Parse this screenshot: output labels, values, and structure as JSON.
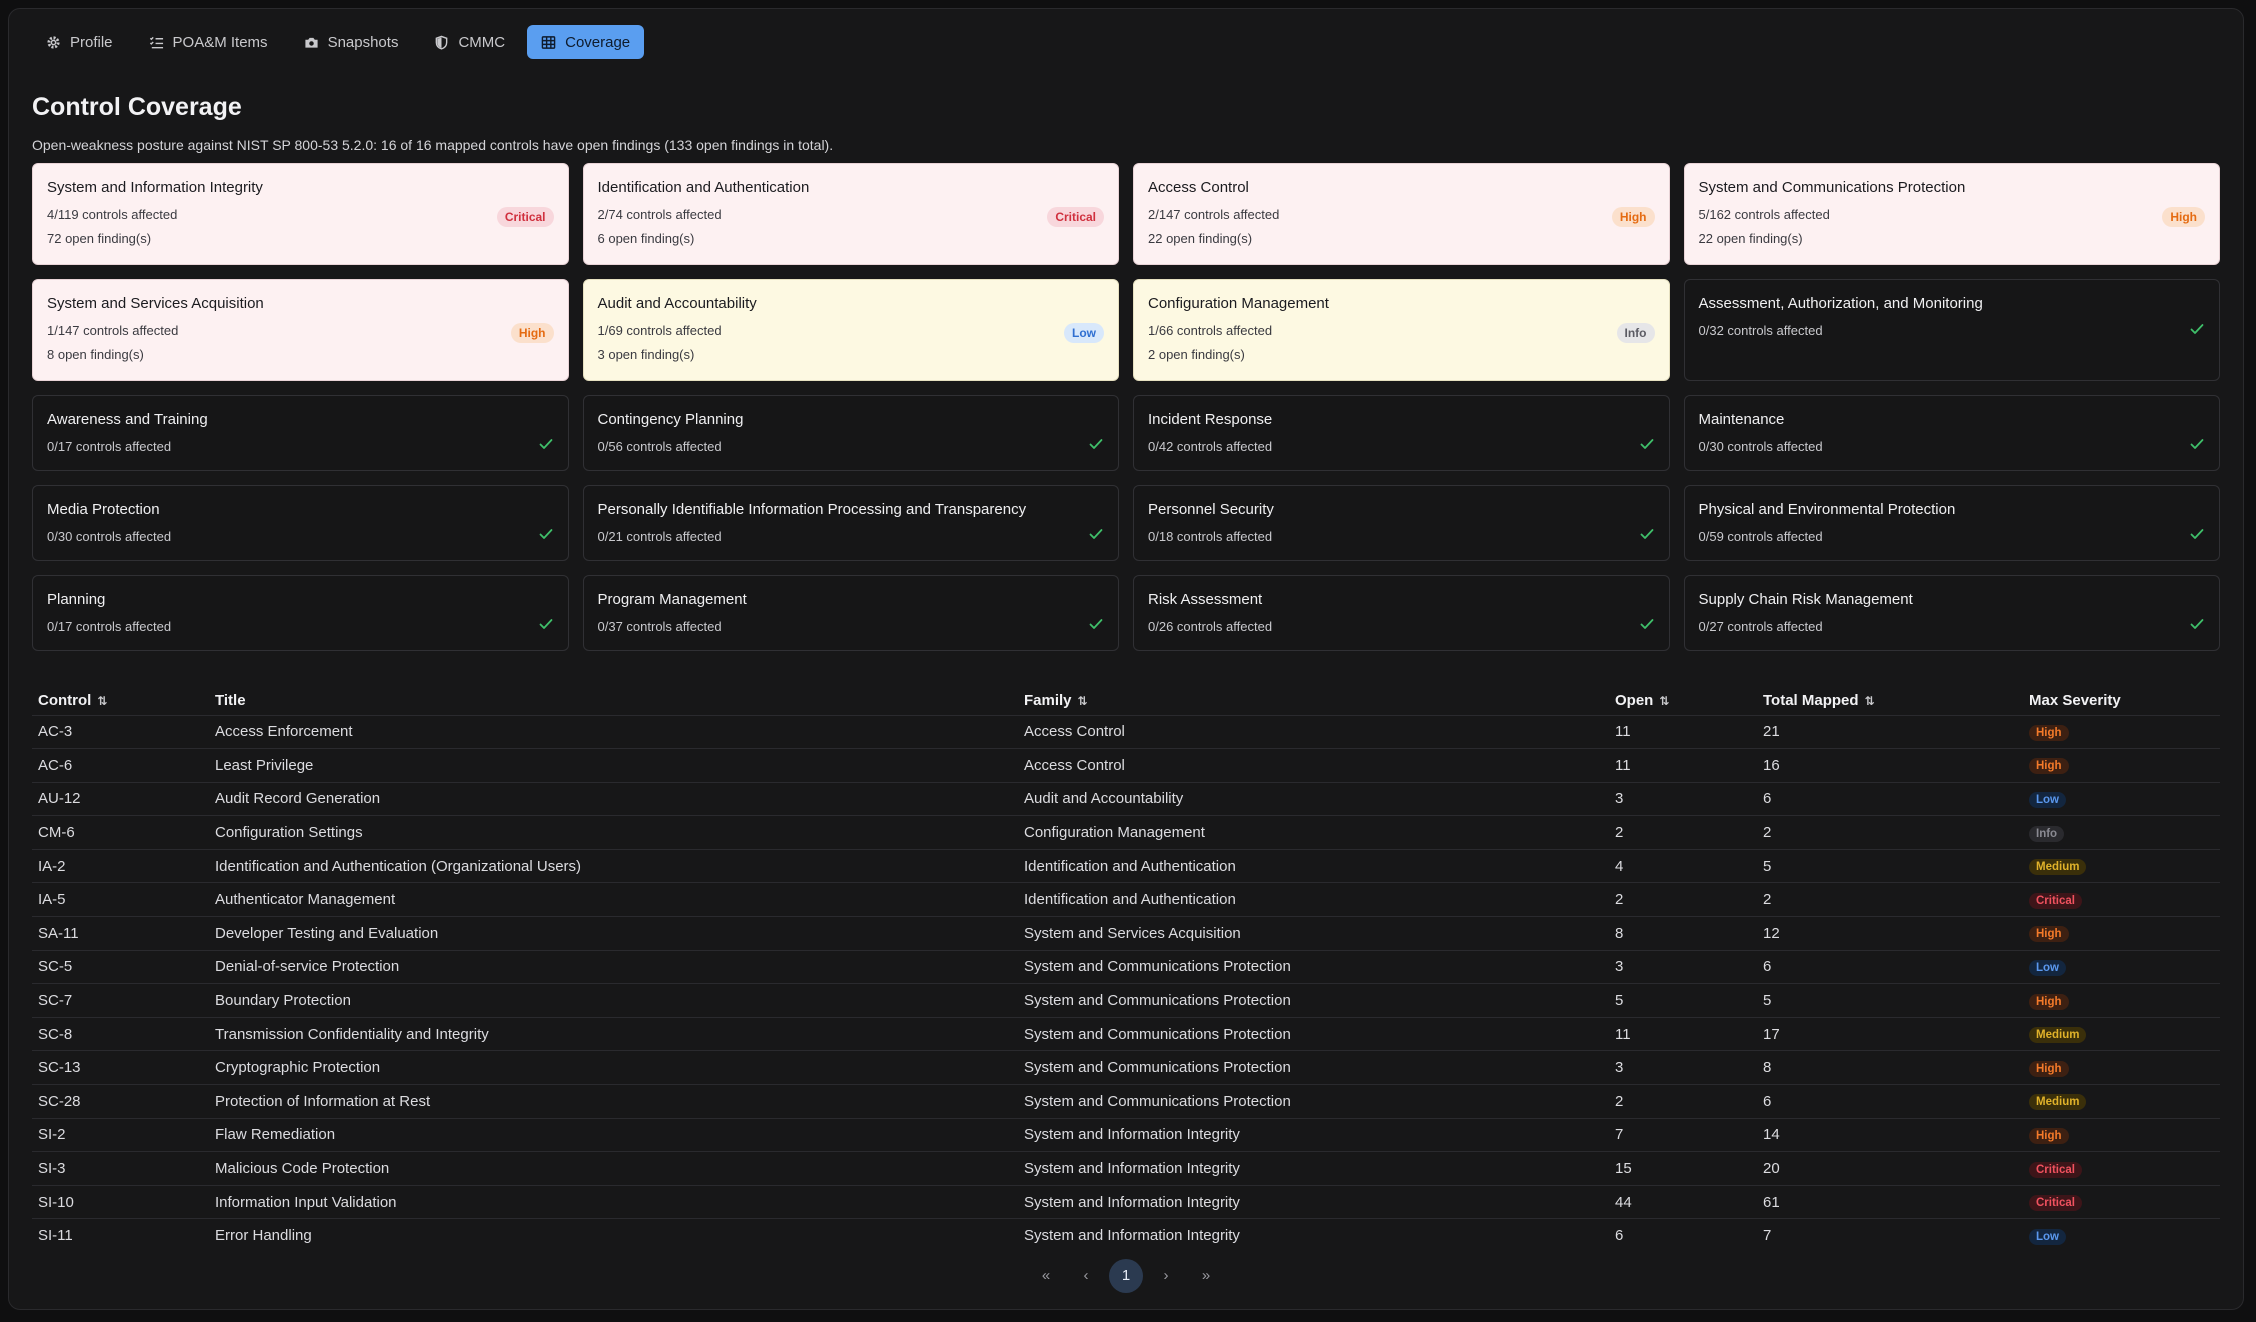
{
  "tabs": [
    {
      "label": "Profile",
      "icon": "gear-icon"
    },
    {
      "label": "POA&M Items",
      "icon": "list-icon"
    },
    {
      "label": "Snapshots",
      "icon": "camera-icon"
    },
    {
      "label": "CMMC",
      "icon": "shield-icon"
    },
    {
      "label": "Coverage",
      "icon": "table-icon",
      "active": true
    }
  ],
  "title": "Control Coverage",
  "subtitle": "Open-weakness posture against NIST SP 800-53 5.2.0: 16 of 16 mapped controls have open findings (133 open findings in total).",
  "cards": [
    {
      "name": "System and Information Integrity",
      "affected": "4/119 controls affected",
      "findings": "72 open finding(s)",
      "severity": "Critical"
    },
    {
      "name": "Identification and Authentication",
      "affected": "2/74 controls affected",
      "findings": "6 open finding(s)",
      "severity": "Critical"
    },
    {
      "name": "Access Control",
      "affected": "2/147 controls affected",
      "findings": "22 open finding(s)",
      "severity": "High"
    },
    {
      "name": "System and Communications Protection",
      "affected": "5/162 controls affected",
      "findings": "22 open finding(s)",
      "severity": "High"
    },
    {
      "name": "System and Services Acquisition",
      "affected": "1/147 controls affected",
      "findings": "8 open finding(s)",
      "severity": "High"
    },
    {
      "name": "Audit and Accountability",
      "affected": "1/69 controls affected",
      "findings": "3 open finding(s)",
      "severity": "Low"
    },
    {
      "name": "Configuration Management",
      "affected": "1/66 controls affected",
      "findings": "2 open finding(s)",
      "severity": "Info"
    },
    {
      "name": "Assessment, Authorization, and Monitoring",
      "affected": "0/32 controls affected"
    },
    {
      "name": "Awareness and Training",
      "affected": "0/17 controls affected"
    },
    {
      "name": "Contingency Planning",
      "affected": "0/56 controls affected"
    },
    {
      "name": "Incident Response",
      "affected": "0/42 controls affected"
    },
    {
      "name": "Maintenance",
      "affected": "0/30 controls affected"
    },
    {
      "name": "Media Protection",
      "affected": "0/30 controls affected"
    },
    {
      "name": "Personally Identifiable Information Processing and Transparency",
      "affected": "0/21 controls affected"
    },
    {
      "name": "Personnel Security",
      "affected": "0/18 controls affected"
    },
    {
      "name": "Physical and Environmental Protection",
      "affected": "0/59 controls affected"
    },
    {
      "name": "Planning",
      "affected": "0/17 controls affected"
    },
    {
      "name": "Program Management",
      "affected": "0/37 controls affected"
    },
    {
      "name": "Risk Assessment",
      "affected": "0/26 controls affected"
    },
    {
      "name": "Supply Chain Risk Management",
      "affected": "0/27 controls affected"
    }
  ],
  "table": {
    "headers": {
      "control": "Control",
      "title": "Title",
      "family": "Family",
      "open": "Open",
      "total": "Total Mapped",
      "severity": "Max Severity"
    },
    "rows": [
      {
        "control": "AC-3",
        "title": "Access Enforcement",
        "family": "Access Control",
        "open": "11",
        "total": "21",
        "severity": "High"
      },
      {
        "control": "AC-6",
        "title": "Least Privilege",
        "family": "Access Control",
        "open": "11",
        "total": "16",
        "severity": "High"
      },
      {
        "control": "AU-12",
        "title": "Audit Record Generation",
        "family": "Audit and Accountability",
        "open": "3",
        "total": "6",
        "severity": "Low"
      },
      {
        "control": "CM-6",
        "title": "Configuration Settings",
        "family": "Configuration Management",
        "open": "2",
        "total": "2",
        "severity": "Info"
      },
      {
        "control": "IA-2",
        "title": "Identification and Authentication (Organizational Users)",
        "family": "Identification and Authentication",
        "open": "4",
        "total": "5",
        "severity": "Medium"
      },
      {
        "control": "IA-5",
        "title": "Authenticator Management",
        "family": "Identification and Authentication",
        "open": "2",
        "total": "2",
        "severity": "Critical"
      },
      {
        "control": "SA-11",
        "title": "Developer Testing and Evaluation",
        "family": "System and Services Acquisition",
        "open": "8",
        "total": "12",
        "severity": "High"
      },
      {
        "control": "SC-5",
        "title": "Denial-of-service Protection",
        "family": "System and Communications Protection",
        "open": "3",
        "total": "6",
        "severity": "Low"
      },
      {
        "control": "SC-7",
        "title": "Boundary Protection",
        "family": "System and Communications Protection",
        "open": "5",
        "total": "5",
        "severity": "High"
      },
      {
        "control": "SC-8",
        "title": "Transmission Confidentiality and Integrity",
        "family": "System and Communications Protection",
        "open": "11",
        "total": "17",
        "severity": "Medium"
      },
      {
        "control": "SC-13",
        "title": "Cryptographic Protection",
        "family": "System and Communications Protection",
        "open": "3",
        "total": "8",
        "severity": "High"
      },
      {
        "control": "SC-28",
        "title": "Protection of Information at Rest",
        "family": "System and Communications Protection",
        "open": "2",
        "total": "6",
        "severity": "Medium"
      },
      {
        "control": "SI-2",
        "title": "Flaw Remediation",
        "family": "System and Information Integrity",
        "open": "7",
        "total": "14",
        "severity": "High"
      },
      {
        "control": "SI-3",
        "title": "Malicious Code Protection",
        "family": "System and Information Integrity",
        "open": "15",
        "total": "20",
        "severity": "Critical"
      },
      {
        "control": "SI-10",
        "title": "Information Input Validation",
        "family": "System and Information Integrity",
        "open": "44",
        "total": "61",
        "severity": "Critical"
      },
      {
        "control": "SI-11",
        "title": "Error Handling",
        "family": "System and Information Integrity",
        "open": "6",
        "total": "7",
        "severity": "Low"
      }
    ]
  },
  "pagination": {
    "first": "«",
    "prev": "‹",
    "current": "1",
    "next": "›",
    "last": "»"
  },
  "colors": {
    "accent": "#5a9ef0",
    "critical": "#d0303e",
    "high": "#e56b12",
    "low": "#2f6fd1",
    "medium": "#e0b22a",
    "ok": "#3fbf6a"
  }
}
